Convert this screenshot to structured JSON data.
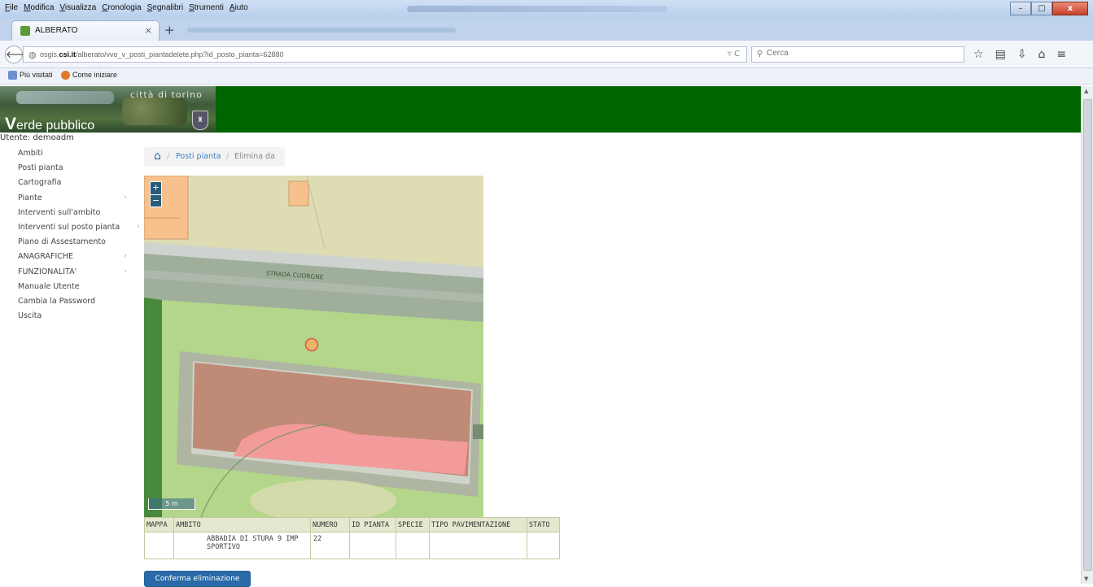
{
  "browser": {
    "menu": [
      "File",
      "Modifica",
      "Visualizza",
      "Cronologia",
      "Segnalibri",
      "Strumenti",
      "Aiuto"
    ],
    "window_buttons": {
      "minimize": "–",
      "maximize": "▢",
      "close": "x"
    },
    "tab": {
      "title": "ALBERATO",
      "close": "×",
      "new_tab": "+"
    },
    "url_prefix": "osgis.",
    "url_host": "csi.it",
    "url_path": "/alberato/vvo_v_posti_piantadelete.php?id_posto_pianta=62880",
    "search_placeholder": "Cerca",
    "bookmarks": [
      "Più visitati",
      "Come iniziare"
    ],
    "tool_icons": [
      "star-icon",
      "clipboard-icon",
      "download-icon",
      "home-icon",
      "menu-icon"
    ]
  },
  "banner": {
    "citta": "città di torino",
    "title_first": "V",
    "title_rest": "erde pubblico"
  },
  "user": {
    "label": "Utente: demoadm"
  },
  "sidebar": {
    "items": [
      {
        "label": "Ambiti",
        "submenu": false
      },
      {
        "label": "Posti pianta",
        "submenu": false
      },
      {
        "label": "Cartografia",
        "submenu": false
      },
      {
        "label": "Piante",
        "submenu": true
      },
      {
        "label": "Interventi sull'ambito",
        "submenu": false
      },
      {
        "label": "Interventi sul posto pianta",
        "submenu": true
      },
      {
        "label": "Piano di Assestamento",
        "submenu": false
      },
      {
        "label": "ANAGRAFICHE",
        "submenu": true
      },
      {
        "label": "FUNZIONALITA'",
        "submenu": true
      },
      {
        "label": "Manuale Utente",
        "submenu": false
      },
      {
        "label": "Cambia la Password",
        "submenu": false
      },
      {
        "label": "Uscita",
        "submenu": false
      }
    ]
  },
  "breadcrumb": {
    "crumb1": "Posti pianta",
    "sep": "/",
    "crumb2": "Elimina da"
  },
  "map": {
    "street_label": "STRADA CUORGNE",
    "zoom_in": "+",
    "zoom_out": "−",
    "scale_label": "5 m",
    "colors": {
      "road": "#9faf9b",
      "sidewalk": "#cfd3d0",
      "lawn": "#b3d68a",
      "building": "#bf8a76",
      "building_pink": "#f39a9a",
      "lot_orange": "#f8c08c",
      "background": "#dedcb2",
      "tree_marker": "#e05a4a"
    }
  },
  "grid": {
    "headers": [
      "MAPPA",
      "AMBITO",
      "NUMERO",
      "ID PIANTA",
      "SPECIE",
      "TIPO PAVIMENTAZIONE",
      "STATO"
    ],
    "rows": [
      {
        "mappa": "",
        "ambito": "ABBADIA DI STURA 9 IMP SPORTIVO",
        "numero": "22",
        "id_pianta": "",
        "specie": "",
        "tipo_pavimentazione": "",
        "stato": ""
      }
    ]
  },
  "buttons": {
    "confirm": "Conferma eliminazione"
  }
}
